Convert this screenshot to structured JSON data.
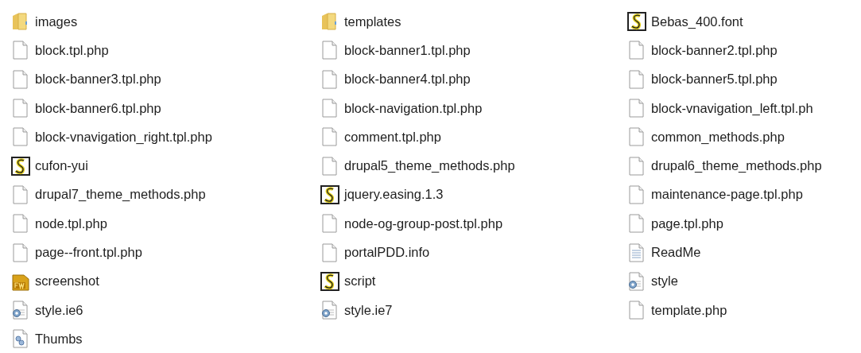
{
  "items": [
    {
      "name": "images",
      "kind": "folder"
    },
    {
      "name": "templates",
      "kind": "folder"
    },
    {
      "name": "Bebas_400.font",
      "kind": "script"
    },
    {
      "name": "block.tpl.php",
      "kind": "file"
    },
    {
      "name": "block-banner1.tpl.php",
      "kind": "file"
    },
    {
      "name": "block-banner2.tpl.php",
      "kind": "file"
    },
    {
      "name": "block-banner3.tpl.php",
      "kind": "file"
    },
    {
      "name": "block-banner4.tpl.php",
      "kind": "file"
    },
    {
      "name": "block-banner5.tpl.php",
      "kind": "file"
    },
    {
      "name": "block-banner6.tpl.php",
      "kind": "file"
    },
    {
      "name": "block-navigation.tpl.php",
      "kind": "file"
    },
    {
      "name": "block-vnavigation_left.tpl.ph",
      "kind": "file"
    },
    {
      "name": "block-vnavigation_right.tpl.php",
      "kind": "file"
    },
    {
      "name": "comment.tpl.php",
      "kind": "file"
    },
    {
      "name": "common_methods.php",
      "kind": "file"
    },
    {
      "name": "cufon-yui",
      "kind": "script"
    },
    {
      "name": "drupal5_theme_methods.php",
      "kind": "file"
    },
    {
      "name": "drupal6_theme_methods.php",
      "kind": "file"
    },
    {
      "name": "drupal7_theme_methods.php",
      "kind": "file"
    },
    {
      "name": "jquery.easing.1.3",
      "kind": "script"
    },
    {
      "name": "maintenance-page.tpl.php",
      "kind": "file"
    },
    {
      "name": "node.tpl.php",
      "kind": "file"
    },
    {
      "name": "node-og-group-post.tpl.php",
      "kind": "file"
    },
    {
      "name": "page.tpl.php",
      "kind": "file"
    },
    {
      "name": "page--front.tpl.php",
      "kind": "file"
    },
    {
      "name": "portalPDD.info",
      "kind": "file"
    },
    {
      "name": "ReadMe",
      "kind": "text"
    },
    {
      "name": "screenshot",
      "kind": "fireworks"
    },
    {
      "name": "script",
      "kind": "script"
    },
    {
      "name": "style",
      "kind": "css"
    },
    {
      "name": "style.ie6",
      "kind": "css"
    },
    {
      "name": "style.ie7",
      "kind": "css"
    },
    {
      "name": "template.php",
      "kind": "file"
    },
    {
      "name": "Thumbs",
      "kind": "thumbs"
    }
  ]
}
